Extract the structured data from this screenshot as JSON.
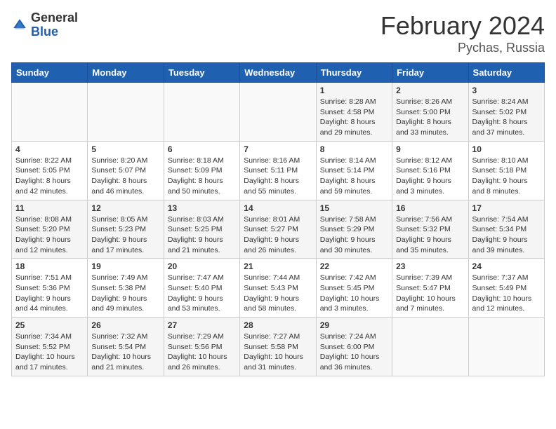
{
  "header": {
    "logo_general": "General",
    "logo_blue": "Blue",
    "month_title": "February 2024",
    "location": "Pychas, Russia"
  },
  "weekdays": [
    "Sunday",
    "Monday",
    "Tuesday",
    "Wednesday",
    "Thursday",
    "Friday",
    "Saturday"
  ],
  "weeks": [
    [
      {
        "day": "",
        "info": ""
      },
      {
        "day": "",
        "info": ""
      },
      {
        "day": "",
        "info": ""
      },
      {
        "day": "",
        "info": ""
      },
      {
        "day": "1",
        "info": "Sunrise: 8:28 AM\nSunset: 4:58 PM\nDaylight: 8 hours\nand 29 minutes."
      },
      {
        "day": "2",
        "info": "Sunrise: 8:26 AM\nSunset: 5:00 PM\nDaylight: 8 hours\nand 33 minutes."
      },
      {
        "day": "3",
        "info": "Sunrise: 8:24 AM\nSunset: 5:02 PM\nDaylight: 8 hours\nand 37 minutes."
      }
    ],
    [
      {
        "day": "4",
        "info": "Sunrise: 8:22 AM\nSunset: 5:05 PM\nDaylight: 8 hours\nand 42 minutes."
      },
      {
        "day": "5",
        "info": "Sunrise: 8:20 AM\nSunset: 5:07 PM\nDaylight: 8 hours\nand 46 minutes."
      },
      {
        "day": "6",
        "info": "Sunrise: 8:18 AM\nSunset: 5:09 PM\nDaylight: 8 hours\nand 50 minutes."
      },
      {
        "day": "7",
        "info": "Sunrise: 8:16 AM\nSunset: 5:11 PM\nDaylight: 8 hours\nand 55 minutes."
      },
      {
        "day": "8",
        "info": "Sunrise: 8:14 AM\nSunset: 5:14 PM\nDaylight: 8 hours\nand 59 minutes."
      },
      {
        "day": "9",
        "info": "Sunrise: 8:12 AM\nSunset: 5:16 PM\nDaylight: 9 hours\nand 3 minutes."
      },
      {
        "day": "10",
        "info": "Sunrise: 8:10 AM\nSunset: 5:18 PM\nDaylight: 9 hours\nand 8 minutes."
      }
    ],
    [
      {
        "day": "11",
        "info": "Sunrise: 8:08 AM\nSunset: 5:20 PM\nDaylight: 9 hours\nand 12 minutes."
      },
      {
        "day": "12",
        "info": "Sunrise: 8:05 AM\nSunset: 5:23 PM\nDaylight: 9 hours\nand 17 minutes."
      },
      {
        "day": "13",
        "info": "Sunrise: 8:03 AM\nSunset: 5:25 PM\nDaylight: 9 hours\nand 21 minutes."
      },
      {
        "day": "14",
        "info": "Sunrise: 8:01 AM\nSunset: 5:27 PM\nDaylight: 9 hours\nand 26 minutes."
      },
      {
        "day": "15",
        "info": "Sunrise: 7:58 AM\nSunset: 5:29 PM\nDaylight: 9 hours\nand 30 minutes."
      },
      {
        "day": "16",
        "info": "Sunrise: 7:56 AM\nSunset: 5:32 PM\nDaylight: 9 hours\nand 35 minutes."
      },
      {
        "day": "17",
        "info": "Sunrise: 7:54 AM\nSunset: 5:34 PM\nDaylight: 9 hours\nand 39 minutes."
      }
    ],
    [
      {
        "day": "18",
        "info": "Sunrise: 7:51 AM\nSunset: 5:36 PM\nDaylight: 9 hours\nand 44 minutes."
      },
      {
        "day": "19",
        "info": "Sunrise: 7:49 AM\nSunset: 5:38 PM\nDaylight: 9 hours\nand 49 minutes."
      },
      {
        "day": "20",
        "info": "Sunrise: 7:47 AM\nSunset: 5:40 PM\nDaylight: 9 hours\nand 53 minutes."
      },
      {
        "day": "21",
        "info": "Sunrise: 7:44 AM\nSunset: 5:43 PM\nDaylight: 9 hours\nand 58 minutes."
      },
      {
        "day": "22",
        "info": "Sunrise: 7:42 AM\nSunset: 5:45 PM\nDaylight: 10 hours\nand 3 minutes."
      },
      {
        "day": "23",
        "info": "Sunrise: 7:39 AM\nSunset: 5:47 PM\nDaylight: 10 hours\nand 7 minutes."
      },
      {
        "day": "24",
        "info": "Sunrise: 7:37 AM\nSunset: 5:49 PM\nDaylight: 10 hours\nand 12 minutes."
      }
    ],
    [
      {
        "day": "25",
        "info": "Sunrise: 7:34 AM\nSunset: 5:52 PM\nDaylight: 10 hours\nand 17 minutes."
      },
      {
        "day": "26",
        "info": "Sunrise: 7:32 AM\nSunset: 5:54 PM\nDaylight: 10 hours\nand 21 minutes."
      },
      {
        "day": "27",
        "info": "Sunrise: 7:29 AM\nSunset: 5:56 PM\nDaylight: 10 hours\nand 26 minutes."
      },
      {
        "day": "28",
        "info": "Sunrise: 7:27 AM\nSunset: 5:58 PM\nDaylight: 10 hours\nand 31 minutes."
      },
      {
        "day": "29",
        "info": "Sunrise: 7:24 AM\nSunset: 6:00 PM\nDaylight: 10 hours\nand 36 minutes."
      },
      {
        "day": "",
        "info": ""
      },
      {
        "day": "",
        "info": ""
      }
    ]
  ]
}
